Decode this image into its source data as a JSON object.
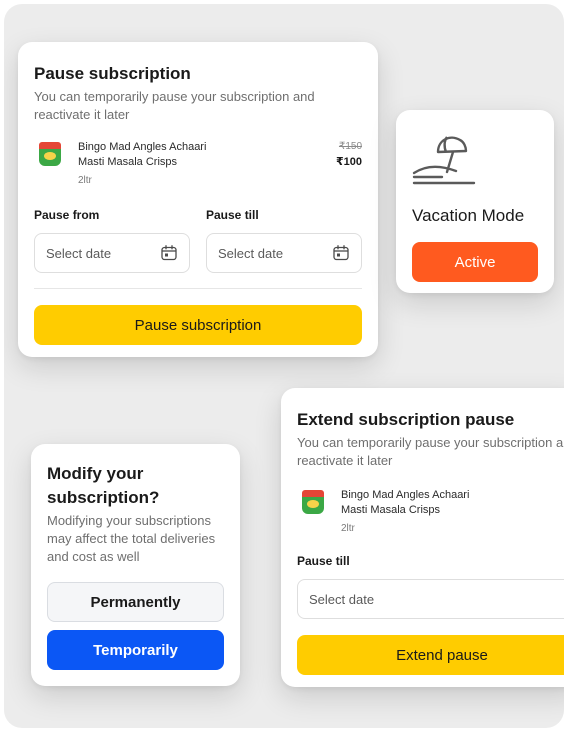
{
  "pause_card": {
    "title": "Pause subscription",
    "subtitle": "You can temporarily pause your subscription and reactivate it later",
    "product": {
      "name_line1": "Bingo Mad Angles Achaari",
      "name_line2": "Masti Masala Crisps",
      "qty": "2ltr",
      "mrp": "₹150",
      "price": "₹100"
    },
    "pause_from_label": "Pause from",
    "pause_till_label": "Pause till",
    "from_placeholder": "Select date",
    "till_placeholder": "Select date",
    "button_label": "Pause subscription"
  },
  "vacation_card": {
    "icon": "beach-umbrella-icon",
    "title": "Vacation Mode",
    "button_label": "Active"
  },
  "modify_card": {
    "title": "Modify your subscription?",
    "subtitle": "Modifying your subscriptions may affect the total deliveries and cost as well",
    "permanent_label": "Permanently",
    "temporary_label": "Temporarily"
  },
  "extend_card": {
    "title": "Extend subscription pause",
    "subtitle": "You can temporarily pause your subscription and reactivate it later",
    "product": {
      "name_line1": "Bingo Mad Angles Achaari",
      "name_line2": "Masti Masala Crisps",
      "qty": "2ltr"
    },
    "pause_till_label": "Pause till",
    "till_placeholder": "Select date",
    "button_label": "Extend pause"
  },
  "colors": {
    "background": "#ececec",
    "primary_yellow": "#ffcc00",
    "active_orange": "#ff5a1f",
    "primary_blue": "#0b57f5"
  }
}
